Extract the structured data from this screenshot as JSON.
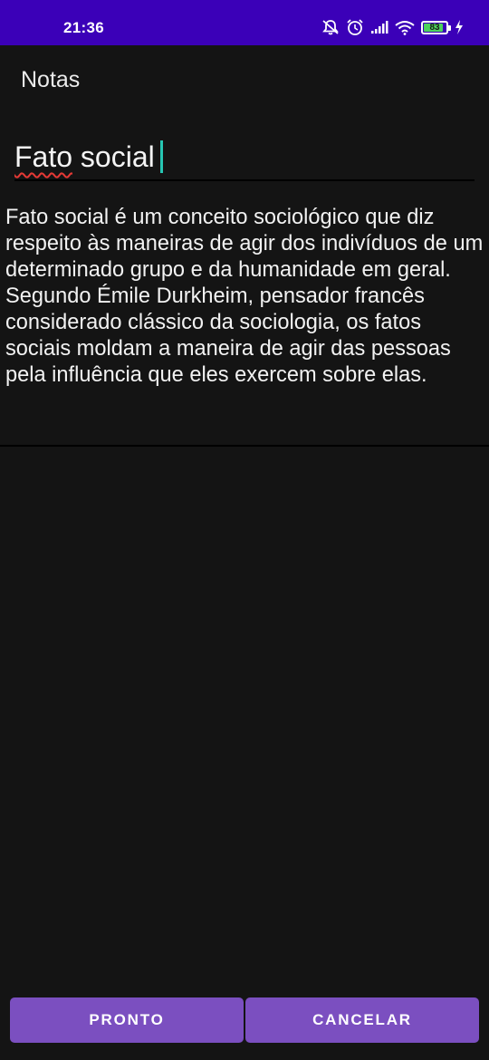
{
  "status_bar": {
    "time": "21:36",
    "battery_level": "83",
    "icons": [
      "mute-icon",
      "alarm-icon",
      "signal-icon",
      "wifi-icon",
      "battery-icon",
      "charging-icon"
    ],
    "background_color": "#3b00b8"
  },
  "header": {
    "title": "Notas"
  },
  "note": {
    "title_value": "Fato social",
    "title_misspelled_word": "Fato",
    "title_rest": " social",
    "body_value": "Fato social é um conceito sociológico que diz respeito às maneiras de agir dos indivíduos de um determinado grupo e da humanidade em geral. Segundo Émile Durkheim, pensador francês considerado clássico da sociologia, os fatos sociais moldam a maneira de agir das pessoas pela influência que eles exercem sobre elas."
  },
  "actions": {
    "done_label": "PRONTO",
    "cancel_label": "CANCELAR",
    "button_color": "#7b4fc0"
  }
}
